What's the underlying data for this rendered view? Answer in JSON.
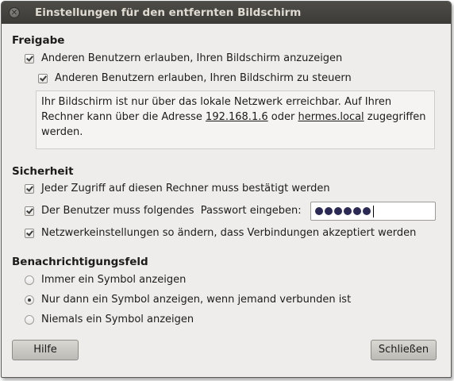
{
  "window": {
    "title": "Einstellungen für den entfernten Bildschirm"
  },
  "freigabe": {
    "heading": "Freigabe",
    "allow_view": {
      "label": "Anderen Benutzern erlauben, Ihren Bildschirm anzuzeigen",
      "checked": true
    },
    "allow_control": {
      "label": "Anderen Benutzern erlauben, Ihren Bildschirm zu steuern",
      "checked": true
    },
    "info": {
      "line1": "Ihr Bildschirm ist nur über das lokale Netzwerk erreichbar. Auf Ihren",
      "line2_prefix": "Rechner kann über die Adresse ",
      "address": "192.168.1.6",
      "or": " oder ",
      "hostname": "hermes.local",
      "line2_suffix": " zugegriffen",
      "line3": "werden."
    }
  },
  "sicherheit": {
    "heading": "Sicherheit",
    "confirm_access": {
      "label": "Jeder Zugriff auf diesen Rechner muss bestätigt werden",
      "checked": true
    },
    "require_password": {
      "label": "Der Benutzer muss folgendes  Passwort eingeben:",
      "checked": true
    },
    "password_length": 6,
    "network_config": {
      "label": "Netzwerkeinstellungen so ändern, dass Verbindungen akzeptiert werden",
      "checked": true
    }
  },
  "benachrichtigung": {
    "heading": "Benachrichtigungsfeld",
    "options": [
      {
        "label": "Immer ein Symbol anzeigen",
        "selected": false
      },
      {
        "label": "Nur dann ein Symbol anzeigen, wenn jemand verbunden ist",
        "selected": true
      },
      {
        "label": "Niemals ein Symbol anzeigen",
        "selected": false
      }
    ]
  },
  "buttons": {
    "help": "Hilfe",
    "close": "Schließen"
  }
}
